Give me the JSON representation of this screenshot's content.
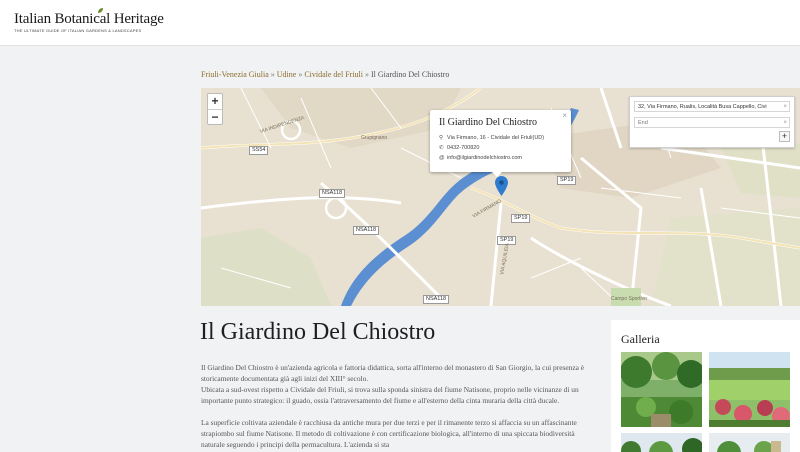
{
  "header": {
    "logo_title": "Italian Botanical Heritage",
    "logo_subtitle": "THE ULTIMATE GUIDE OF ITALIAN GARDENS & LANDSCAPES"
  },
  "breadcrumb": {
    "items": [
      "Friuli-Venezia Giulia",
      "Udine",
      "Cividale del Friuli"
    ],
    "separator": "»",
    "current": "Il Giardino Del Chiostro"
  },
  "map": {
    "zoom_in": "+",
    "zoom_out": "−",
    "popup": {
      "title": "Il Giardino Del Chiostro",
      "address": "Via Firmano, 16 - Cividale del Friuli(UD)",
      "phone": "0432-700820",
      "email": "info@ilgiardinodelchiostro.com",
      "close": "×"
    },
    "directions": {
      "start_value": "32, Via Firmano, Rualis, Località Busa Cappello, Civi",
      "end_placeholder": "End",
      "add_label": "+",
      "clear_label": "×"
    },
    "labels": {
      "sp19_a": "SP19",
      "sp19_b": "SP19",
      "sp19_c": "SP19",
      "nsa118_a": "NSA118",
      "nsa118_b": "NSA118",
      "nsa118_c": "NSA118",
      "ss54": "SS54",
      "grupignano": "Grupignano",
      "via_indipendenza": "VIA INDIPENDENZA",
      "via_firmano": "VIA FIRMANO",
      "via_aquileia": "VIA AQUILEIA",
      "campo_sportivo": "Campo Sportivo"
    }
  },
  "content": {
    "title": "Il Giardino Del Chiostro",
    "paragraph_1": "Il Giardino Del Chiostro è un'azienda agricola e fattoria didattica, sorta all'interno del monastero di San Giorgio, la cui presenza è storicamente documentata già agli inizi del XIII° secolo.",
    "paragraph_2": "Ubicata a sud-ovest rispetto a Cividale del Friuli, si trova sulla sponda sinistra del fiume Natisone, proprio nelle vicinanze di un importante punto strategico: il guado, ossia l'attraversamento del fiume e all'esterno della cinta muraria della città ducale.",
    "paragraph_3": "La superficie coltivata aziendale è racchiusa da antiche mura per due terzi e per il rimanente terzo si affaccia su un affascinante strapiombo sul fiume Natisone. Il metodo di coltivazione è con certificazione biologica, all'interno di una spiccata biodiversità naturale seguendo i principi della permacultura. L'azienda si sta"
  },
  "sidebar": {
    "gallery_title": "Galleria"
  },
  "colors": {
    "link": "#8a6d2b",
    "river": "#5b8fd1",
    "map_land": "#e7dfcf",
    "marker": "#2e7bcf"
  },
  "icons": [
    "map-marker-icon",
    "location-icon",
    "phone-icon",
    "email-icon",
    "close-icon"
  ]
}
